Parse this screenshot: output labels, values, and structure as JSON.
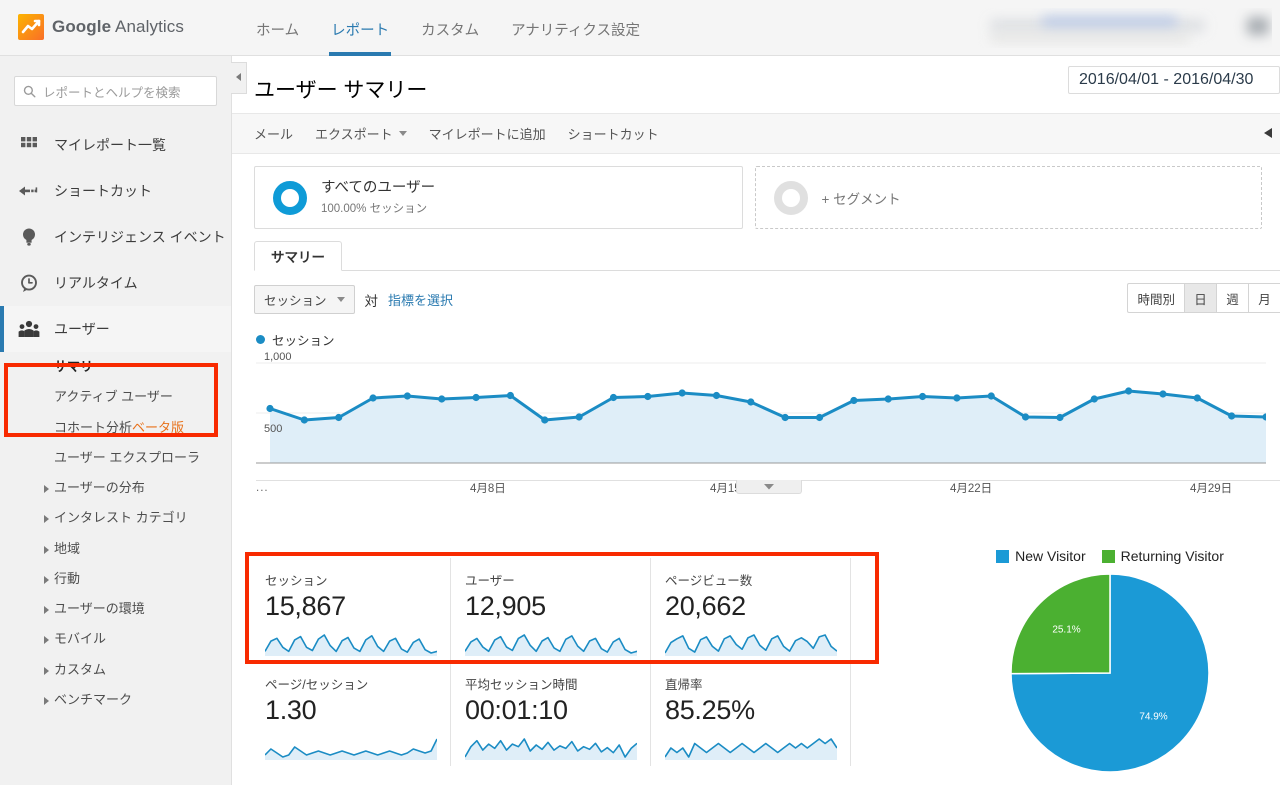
{
  "topbar": {
    "brand_bold": "Google",
    "brand_light": " Analytics",
    "logo_icon": "analytics-logo-icon",
    "nav": [
      {
        "label": "ホーム",
        "active": false
      },
      {
        "label": "レポート",
        "active": true
      },
      {
        "label": "カスタム",
        "active": false
      },
      {
        "label": "アナリティクス設定",
        "active": false
      }
    ]
  },
  "sidebar": {
    "search_placeholder": "レポートとヘルプを検索",
    "search_icon": "search-icon",
    "main_items": [
      {
        "label": "マイレポート一覧",
        "icon": "grid-icon"
      },
      {
        "label": "ショートカット",
        "icon": "arrow-left-dashed-icon"
      },
      {
        "label": "インテリジェンス イベント",
        "icon": "lightbulb-icon"
      },
      {
        "label": "リアルタイム",
        "icon": "clock-bubble-icon"
      },
      {
        "label": "ユーザー",
        "icon": "users-icon"
      }
    ],
    "sub_items": [
      {
        "label": "サマリー",
        "active": true,
        "caret": false
      },
      {
        "label": "アクティブ ユーザー",
        "active": false,
        "caret": false
      },
      {
        "label": "コホート分析",
        "badge": "ベータ版",
        "active": false,
        "caret": false
      },
      {
        "label": "ユーザー エクスプローラ",
        "active": false,
        "caret": false
      },
      {
        "label": "ユーザーの分布",
        "active": false,
        "caret": true
      },
      {
        "label": "インタレスト カテゴリ",
        "active": false,
        "caret": true
      },
      {
        "label": "地域",
        "active": false,
        "caret": true
      },
      {
        "label": "行動",
        "active": false,
        "caret": true
      },
      {
        "label": "ユーザーの環境",
        "active": false,
        "caret": true
      },
      {
        "label": "モバイル",
        "active": false,
        "caret": true
      },
      {
        "label": "カスタム",
        "active": false,
        "caret": true
      },
      {
        "label": "ベンチマーク",
        "active": false,
        "caret": true
      }
    ],
    "collapse_icon": "collapse-left-icon"
  },
  "page": {
    "title": "ユーザー サマリー",
    "date_range": "2016/04/01 - 2016/04/30"
  },
  "toolbar": {
    "items": [
      {
        "label": "メール",
        "caret": false
      },
      {
        "label": "エクスポート",
        "caret": true
      },
      {
        "label": "マイレポートに追加",
        "caret": false
      },
      {
        "label": "ショートカット",
        "caret": false
      }
    ],
    "collapse_icon": "collapse-right-icon"
  },
  "segments": {
    "all_users_name": "すべてのユーザー",
    "all_users_sub": "100.00% セッション",
    "add_segment_label": "+ セグメント"
  },
  "tabs": [
    {
      "label": "サマリー",
      "active": true
    }
  ],
  "chart_controls": {
    "metric_select": "セッション",
    "vs_label": "対",
    "pick_metric_link": "指標を選択",
    "granularity": [
      {
        "label": "時間別",
        "active": false
      },
      {
        "label": "日",
        "active": true
      },
      {
        "label": "週",
        "active": false
      },
      {
        "label": "月",
        "active": false
      }
    ]
  },
  "colors": {
    "accent_blue": "#2a7ab0",
    "line_blue": "#1b8cc4",
    "area_blue": "#dfeef8",
    "pie_new": "#1b9ad6",
    "pie_returning": "#4bb031",
    "highlight_red": "#f82a00",
    "beta_orange": "#e8711a"
  },
  "metric_cards": [
    {
      "label": "セッション",
      "value": "15,867"
    },
    {
      "label": "ユーザー",
      "value": "12,905"
    },
    {
      "label": "ページビュー数",
      "value": "20,662"
    },
    {
      "label": "ページ/セッション",
      "value": "1.30"
    },
    {
      "label": "平均セッション時間",
      "value": "00:01:10"
    },
    {
      "label": "直帰率",
      "value": "85.25%"
    }
  ],
  "chart_data": [
    {
      "type": "line",
      "name": "sessions-over-time",
      "title": "セッション",
      "xlabel": "",
      "ylabel": "",
      "ylim": [
        0,
        1000
      ],
      "yticks": [
        500,
        1000
      ],
      "ytick_labels": [
        "500",
        "1,000"
      ],
      "grid": true,
      "legend": [
        "セッション"
      ],
      "legend_position": "top-left",
      "x_tick_labels": [
        "4月8日",
        "4月15日",
        "4月22日",
        "4月29日"
      ],
      "x_leading_ellipsis": "...",
      "x": [
        "4月1日",
        "4月2日",
        "4月3日",
        "4月4日",
        "4月5日",
        "4月6日",
        "4月7日",
        "4月8日",
        "4月9日",
        "4月10日",
        "4月11日",
        "4月12日",
        "4月13日",
        "4月14日",
        "4月15日",
        "4月16日",
        "4月17日",
        "4月18日",
        "4月19日",
        "4月20日",
        "4月21日",
        "4月22日",
        "4月23日",
        "4月24日",
        "4月25日",
        "4月26日",
        "4月27日",
        "4月28日",
        "4月29日",
        "4月30日"
      ],
      "values": [
        545,
        430,
        455,
        650,
        670,
        640,
        655,
        675,
        430,
        460,
        655,
        665,
        700,
        675,
        610,
        455,
        455,
        625,
        640,
        665,
        650,
        670,
        460,
        455,
        640,
        720,
        690,
        650,
        470,
        460
      ]
    },
    {
      "type": "pie",
      "name": "new-vs-returning",
      "labels": [
        "New Visitor",
        "Returning Visitor"
      ],
      "values": [
        74.9,
        25.1
      ],
      "value_labels": [
        "74.9%",
        "25.1%"
      ],
      "colors": [
        "#1b9ad6",
        "#4bb031"
      ],
      "legend_position": "top"
    },
    {
      "type": "line",
      "name": "sparkline-sessions",
      "values": [
        30,
        55,
        62,
        40,
        30,
        58,
        66,
        40,
        32,
        60,
        70,
        44,
        30,
        56,
        64,
        38,
        30,
        58,
        68,
        42,
        30,
        55,
        62,
        36,
        28,
        52,
        60,
        34,
        26,
        30
      ]
    },
    {
      "type": "line",
      "name": "sparkline-users",
      "values": [
        28,
        50,
        58,
        38,
        28,
        54,
        62,
        38,
        30,
        58,
        66,
        42,
        28,
        52,
        60,
        36,
        28,
        56,
        64,
        40,
        28,
        52,
        58,
        34,
        26,
        50,
        58,
        32,
        24,
        28
      ]
    },
    {
      "type": "line",
      "name": "sparkline-pageviews",
      "values": [
        26,
        48,
        56,
        62,
        36,
        28,
        54,
        60,
        40,
        30,
        56,
        62,
        44,
        34,
        58,
        64,
        42,
        32,
        56,
        62,
        40,
        30,
        52,
        58,
        50,
        36,
        60,
        64,
        40,
        30
      ]
    },
    {
      "type": "line",
      "name": "sparkline-pages-per-session",
      "values": [
        36,
        42,
        38,
        34,
        36,
        44,
        40,
        36,
        38,
        40,
        38,
        36,
        38,
        40,
        38,
        36,
        38,
        40,
        38,
        36,
        38,
        40,
        38,
        36,
        38,
        42,
        40,
        38,
        40,
        52
      ]
    },
    {
      "type": "line",
      "name": "sparkline-avg-session-duration",
      "values": [
        20,
        44,
        58,
        36,
        50,
        40,
        58,
        36,
        50,
        44,
        62,
        34,
        48,
        38,
        54,
        36,
        46,
        40,
        56,
        34,
        44,
        38,
        52,
        32,
        42,
        30,
        48,
        20,
        40,
        52
      ]
    },
    {
      "type": "line",
      "name": "sparkline-bounce-rate",
      "values": [
        46,
        48,
        47,
        48,
        46,
        49,
        48,
        47,
        48,
        49,
        48,
        47,
        48,
        49,
        48,
        47,
        48,
        49,
        48,
        47,
        48,
        49,
        48,
        49,
        48,
        49,
        50,
        49,
        50,
        48
      ]
    }
  ]
}
